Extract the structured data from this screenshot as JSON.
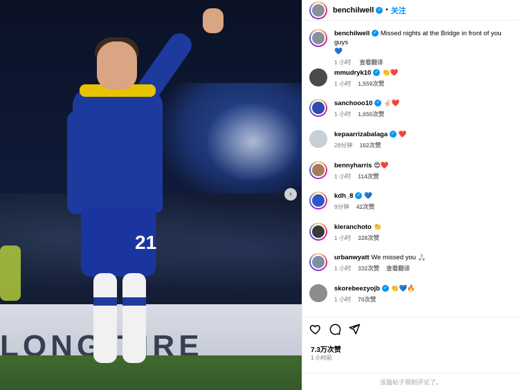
{
  "header": {
    "username": "benchilwell",
    "follow_label": "关注",
    "separator": "•"
  },
  "post": {
    "caption_user": "benchilwell",
    "caption": "Missed nights at the Bridge in front of you guys",
    "caption_emoji": "💙",
    "caption_time": "1 小时",
    "caption_action": "查看翻译"
  },
  "comments": [
    {
      "user": "mmudryk10",
      "text": "👏❤️",
      "time": "1 小时",
      "likes": "1,559次赞",
      "action": ""
    },
    {
      "user": "sanchooo10",
      "text": "✌🏻❤️",
      "time": "1 小时",
      "likes": "1,650次赞",
      "action": ""
    },
    {
      "user": "kepaarrizabalaga",
      "text": "❤️",
      "time": "28分钟",
      "likes": "162次赞",
      "action": ""
    },
    {
      "user": "bennyharris",
      "text": "😍❤️",
      "time": "1 小时",
      "likes": "114次赞",
      "action": ""
    },
    {
      "user": "kdh_8",
      "text": "💙",
      "time": "9分钟",
      "likes": "42次赞",
      "action": ""
    },
    {
      "user": "kieranchoto",
      "text": "👏",
      "time": "1 小时",
      "likes": "328次赞",
      "action": ""
    },
    {
      "user": "urbanwyatt",
      "text": "We missed you 🙏🏻",
      "time": "1 小时",
      "likes": "332次赞",
      "action": "查看翻译"
    },
    {
      "user": "skorebeezyojb",
      "text": "👏💙🔥",
      "time": "1 小时",
      "likes": "70次赞",
      "action": ""
    }
  ],
  "footer": {
    "likes": "7.3万次赞",
    "time": "1 小时前",
    "restricted": "该篇帖子限制评论了。"
  },
  "photo": {
    "jersey_number": "21",
    "hoarding_text": "LONG TIRE"
  },
  "colors": {
    "verified": "#0095f6",
    "follow": "#0095f6",
    "muted": "#737373"
  }
}
